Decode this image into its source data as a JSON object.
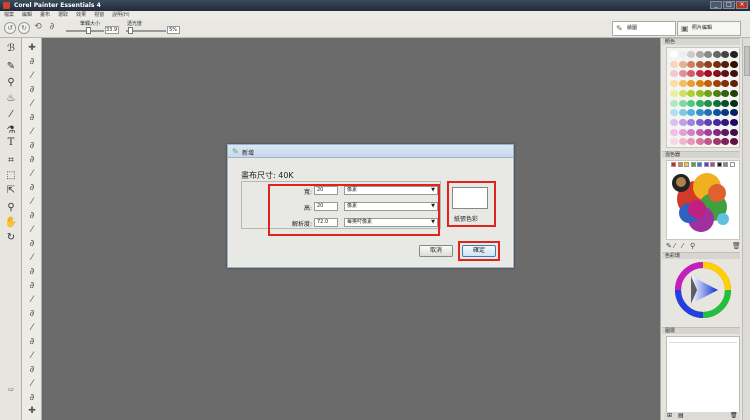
{
  "window": {
    "title": "Corel Painter Essentials 4",
    "buttons": [
      "_",
      "□",
      "×"
    ]
  },
  "menubar": [
    "檔案",
    "編輯",
    "畫布",
    "選取",
    "效果",
    "視窗",
    "說明(H)"
  ],
  "propbar": {
    "brush_size_label": "筆觸大小",
    "brush_size_value": "33.9",
    "opacity_label": "透光度",
    "opacity_value": "5%",
    "tab_paint": "繪圖",
    "tab_photo": "照片編輯"
  },
  "right_panel": {
    "colors_title": "顏色",
    "mixer_title": "混色器",
    "color_wheel_title": "色彩環",
    "layers_title": "圖層"
  },
  "dialog": {
    "title": "新增",
    "canvas_size": "畫布尺寸: 40K",
    "width_label": "寬:",
    "width_value": "20",
    "width_unit": "像素",
    "height_label": "高:",
    "height_value": "20",
    "height_unit": "像素",
    "resolution_label": "解析度:",
    "resolution_value": "72.0",
    "resolution_unit": "每英吋像素",
    "paper_color_label": "紙張色彩",
    "cancel_label": "取消",
    "ok_label": "確定"
  },
  "colors": {
    "workspace": "#6b6b6b",
    "highlight": "#e0241d"
  }
}
